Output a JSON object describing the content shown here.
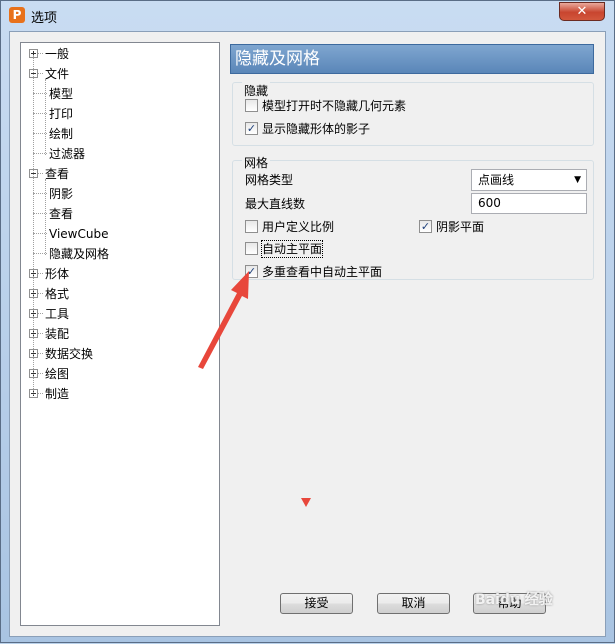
{
  "window": {
    "title": "选项",
    "app_icon": "P",
    "close_label": "✕"
  },
  "tree": {
    "items": [
      {
        "label": "一般",
        "level": 0,
        "expander": "plus"
      },
      {
        "label": "文件",
        "level": 0,
        "expander": "minus"
      },
      {
        "label": "模型",
        "level": 1
      },
      {
        "label": "打印",
        "level": 1
      },
      {
        "label": "绘制",
        "level": 1
      },
      {
        "label": "过滤器",
        "level": 1
      },
      {
        "label": "查看",
        "level": 0,
        "expander": "minus"
      },
      {
        "label": "阴影",
        "level": 1
      },
      {
        "label": "查看",
        "level": 1
      },
      {
        "label": "ViewCube",
        "level": 1
      },
      {
        "label": "隐藏及网格",
        "level": 1
      },
      {
        "label": "形体",
        "level": 0,
        "expander": "plus"
      },
      {
        "label": "格式",
        "level": 0,
        "expander": "plus"
      },
      {
        "label": "工具",
        "level": 0,
        "expander": "plus"
      },
      {
        "label": "装配",
        "level": 0,
        "expander": "plus"
      },
      {
        "label": "数据交换",
        "level": 0,
        "expander": "plus"
      },
      {
        "label": "绘图",
        "level": 0,
        "expander": "plus"
      },
      {
        "label": "制造",
        "level": 0,
        "expander": "plus"
      }
    ]
  },
  "panel": {
    "title": "隐藏及网格",
    "hide_group": {
      "title": "隐藏",
      "options": [
        {
          "label": "模型打开时不隐藏几何元素",
          "checked": false
        },
        {
          "label": "显示隐藏形体的影子",
          "checked": true
        }
      ]
    },
    "grid_group": {
      "title": "网格",
      "grid_type_label": "网格类型",
      "grid_type_value": "点画线",
      "max_lines_label": "最大直线数",
      "max_lines_value": "600",
      "user_scale": {
        "label": "用户定义比例",
        "checked": false
      },
      "shadow_plane": {
        "label": "阴影平面",
        "checked": true
      },
      "auto_main_plane": {
        "label": "自动主平面",
        "checked": false
      },
      "multi_view_auto": {
        "label": "多重查看中自动主平面",
        "checked": true
      }
    }
  },
  "buttons": {
    "accept": "接受",
    "cancel": "取消",
    "help": "帮助"
  },
  "watermark": "Baidu 经验",
  "colors": {
    "accent_header": "#5a86b8",
    "annotation_arrow": "#e8473b"
  }
}
